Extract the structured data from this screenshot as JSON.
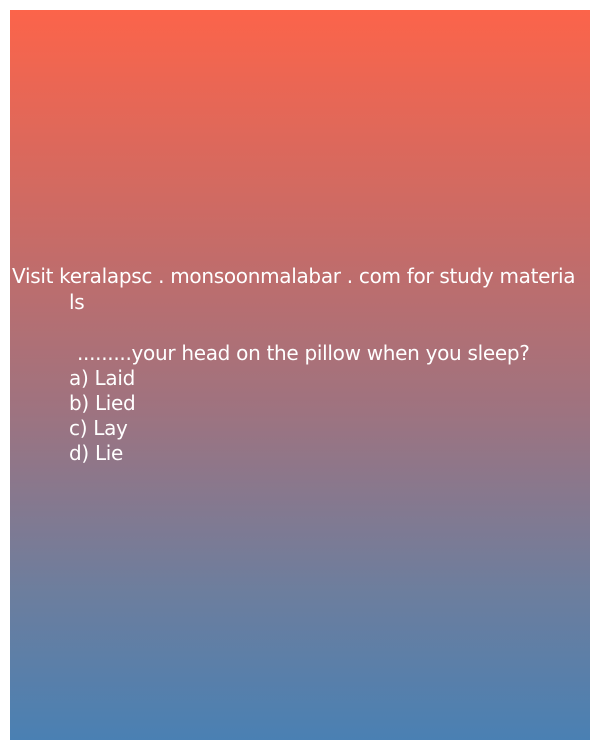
{
  "promo": {
    "line1": "Visit keralapsc . monsoonmalabar . com for study materia",
    "line2": "ls"
  },
  "question": {
    "text": ".........your head on the pillow when you sleep?",
    "options": [
      "a) Laid",
      "b) Lied",
      "c) Lay",
      "d) Lie"
    ]
  },
  "colors": {
    "gradient_top": "#fc644a",
    "gradient_bottom": "#4a80b3",
    "text": "#ffffff"
  }
}
